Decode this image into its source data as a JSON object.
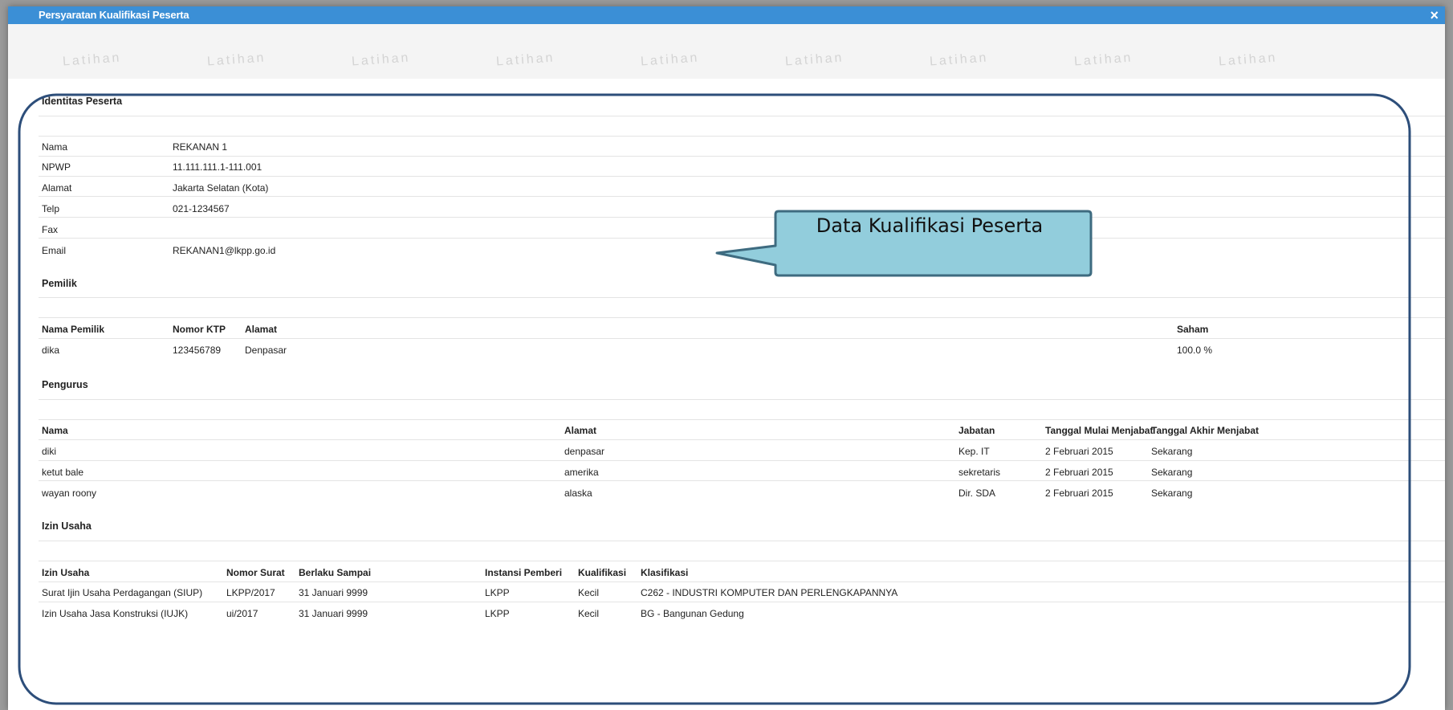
{
  "modal": {
    "title": "Persyaratan Kualifikasi Peserta",
    "close_glyph": "×"
  },
  "watermark": "Latihan",
  "identitas": {
    "title": "Identitas Peserta",
    "rows": [
      {
        "label": "Nama",
        "value": "REKANAN 1"
      },
      {
        "label": "NPWP",
        "value": "11.111.111.1-111.001"
      },
      {
        "label": "Alamat",
        "value": "Jakarta Selatan (Kota)"
      },
      {
        "label": "Telp",
        "value": "021-1234567"
      },
      {
        "label": "Fax",
        "value": ""
      },
      {
        "label": "Email",
        "value": "REKANAN1@lkpp.go.id"
      }
    ]
  },
  "pemilik": {
    "title": "Pemilik",
    "headers": {
      "nama": "Nama Pemilik",
      "ktp": "Nomor KTP",
      "alamat": "Alamat",
      "saham": "Saham"
    },
    "rows": [
      {
        "nama": "dika",
        "ktp": "123456789",
        "alamat": "Denpasar",
        "saham": "100.0 %"
      }
    ]
  },
  "pengurus": {
    "title": "Pengurus",
    "headers": {
      "nama": "Nama",
      "alamat": "Alamat",
      "jabatan": "Jabatan",
      "mulai": "Tanggal Mulai Menjabat",
      "akhir": "Tanggal Akhir Menjabat"
    },
    "rows": [
      {
        "nama": "diki",
        "alamat": "denpasar",
        "jabatan": "Kep. IT",
        "mulai": "2 Februari 2015",
        "akhir": "Sekarang"
      },
      {
        "nama": "ketut bale",
        "alamat": "amerika",
        "jabatan": "sekretaris",
        "mulai": "2 Februari 2015",
        "akhir": "Sekarang"
      },
      {
        "nama": "wayan roony",
        "alamat": "alaska",
        "jabatan": "Dir. SDA",
        "mulai": "2 Februari 2015",
        "akhir": "Sekarang"
      }
    ]
  },
  "izin": {
    "title": "Izin Usaha",
    "headers": {
      "izin": "Izin Usaha",
      "nomor": "Nomor Surat",
      "berlaku": "Berlaku Sampai",
      "instansi": "Instansi Pemberi",
      "kualifikasi": "Kualifikasi",
      "klasifikasi": "Klasifikasi"
    },
    "rows": [
      {
        "izin": "Surat Ijin Usaha Perdagangan (SIUP)",
        "nomor": "LKPP/2017",
        "berlaku": "31 Januari 9999",
        "instansi": "LKPP",
        "kualifikasi": "Kecil",
        "klasifikasi": "C262 - INDUSTRI KOMPUTER DAN PERLENGKAPANNYA"
      },
      {
        "izin": "Izin Usaha Jasa Konstruksi (IUJK)",
        "nomor": "ui/2017",
        "berlaku": "31 Januari 9999",
        "instansi": "LKPP",
        "kualifikasi": "Kecil",
        "klasifikasi": "BG - Bangunan Gedung"
      }
    ]
  },
  "callout": {
    "text": "Data Kualifikasi Peserta",
    "fill": "#92cddc",
    "border": "#3e6b80",
    "frame_color": "#2d4e7a"
  }
}
